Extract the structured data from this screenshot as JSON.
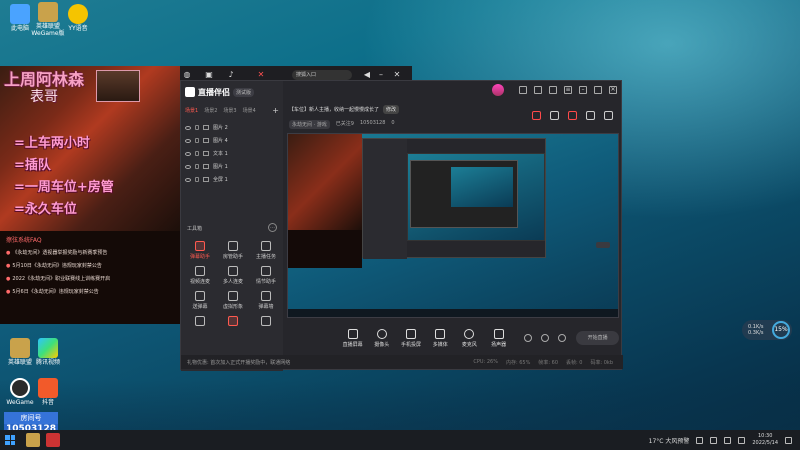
{
  "desktop": {
    "icons": [
      {
        "label": "此电脑",
        "color": "#4aa3ff"
      },
      {
        "label": "英雄联盟 WeGame版",
        "color": "#c9a24b"
      },
      {
        "label": "YY语音",
        "color": "#f5c400"
      },
      {
        "label": "英雄联盟",
        "color": "#c9a24b"
      },
      {
        "label": "腾讯视频",
        "color": "#2ec4ff"
      },
      {
        "label": "WeGame",
        "color": "#ffffff"
      },
      {
        "label": "抖音",
        "color": "#f25a2a"
      }
    ]
  },
  "overlay": {
    "title": "上周阿林森",
    "subtitle": "表哥",
    "rules": [
      "=上车两小时",
      "=插队",
      "=一周车位+房管",
      "=永久车位"
    ],
    "faq_title": "擦弦系统FAQ",
    "faq_items": [
      "《永劫无间》透视器举报奖励与新赛季预告",
      "5月10日《永劫无间》违规玩家封禁公告",
      "2022《永劫无间》职业联赛线上训练赛开启",
      "5月6日《永劫无间》违规玩家封禁公告"
    ]
  },
  "bg_strip": {
    "search_text": "搜狐入口"
  },
  "app": {
    "name": "直播伴侣",
    "version": "测试版",
    "source_tabs": [
      "场景1",
      "场景2",
      "场景3",
      "场景4"
    ],
    "sources": [
      "图片 2",
      "图片 4",
      "文本 1",
      "图片 1",
      "全屏 1"
    ],
    "tools_label": "工具箱",
    "tools": [
      {
        "label": "弹幕助手",
        "active": true
      },
      {
        "label": "房管助手",
        "active": false
      },
      {
        "label": "主播任务",
        "active": false
      },
      {
        "label": "视频连麦",
        "active": false
      },
      {
        "label": "多人连麦",
        "active": false
      },
      {
        "label": "情节助手",
        "active": false
      },
      {
        "label": "送弹幕",
        "active": false
      },
      {
        "label": "虚拟形象",
        "active": false
      },
      {
        "label": "弹幕墙",
        "active": false
      },
      {
        "label": "",
        "active": false
      },
      {
        "label": "",
        "active": false
      },
      {
        "label": "",
        "active": false
      }
    ],
    "room_title": "【车位】新人主播，收纳一起慢慢成长了",
    "edit_label": "修改",
    "room_category": "永劫无间 · 游戏",
    "room_follow": "已关注9",
    "room_id": "10503128",
    "room_likes": "0",
    "controls": [
      "直播屏幕",
      "摄像头",
      "手机投屏",
      "多媒体",
      "麦克风",
      "扬声器"
    ],
    "start_live_label": "开始直播",
    "notice": "礼物优惠: 首次加入正式开播奖励中，联通网络",
    "stats": [
      "CPU: 26%",
      "内存: 65%",
      "帧率: 60",
      "丢帧: 0",
      "码率: 0kb"
    ]
  },
  "speed_widget": {
    "up": "0.1K/s",
    "down": "0.3K/s",
    "percent": "15%"
  },
  "id_badge": {
    "name": "房间号",
    "number": "10503128"
  },
  "taskbar": {
    "weather": "17°C 大风预警",
    "time": "10:30",
    "date": "2022/5/14"
  }
}
